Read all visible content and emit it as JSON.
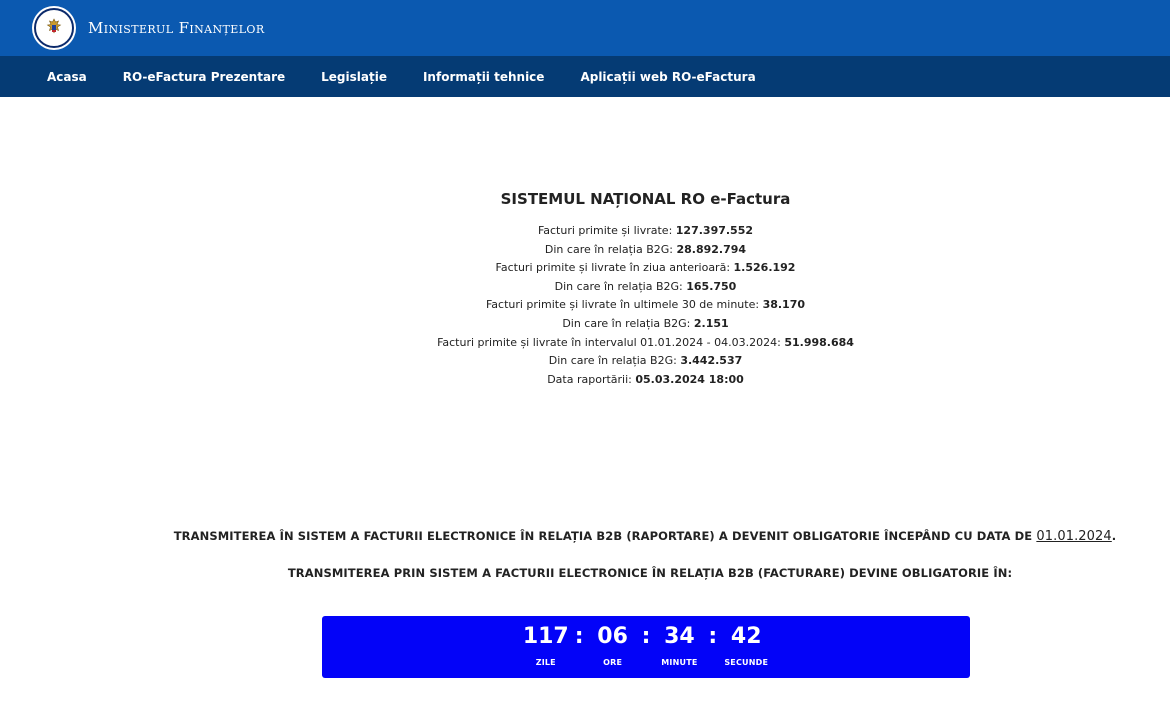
{
  "header": {
    "ministry_name": "Ministerul Finanțelor",
    "crest_icon": "romanian-government-crest-icon",
    "colors": {
      "topbar": "#0b59b0",
      "navbar": "#053b74"
    }
  },
  "nav": {
    "items": [
      {
        "label": "Acasa"
      },
      {
        "label": "RO-eFactura Prezentare"
      },
      {
        "label": "Legislație"
      },
      {
        "label": "Informații tehnice"
      },
      {
        "label": "Aplicații web RO-eFactura"
      }
    ]
  },
  "stats": {
    "title": "SISTEMUL NAȚIONAL RO e-Factura",
    "lines": [
      {
        "label": "Facturi primite și livrate: ",
        "value": "127.397.552"
      },
      {
        "label": "Din care în relația B2G: ",
        "value": "28.892.794"
      },
      {
        "label": "Facturi primite și livrate în ziua anterioară: ",
        "value": "1.526.192"
      },
      {
        "label": "Din care în relația B2G: ",
        "value": "165.750"
      },
      {
        "label": "Facturi primite și livrate în ultimele 30 de minute: ",
        "value": "38.170"
      },
      {
        "label": "Din care în relația B2G: ",
        "value": "2.151"
      },
      {
        "label": "Facturi primite și livrate în intervalul 01.01.2024 - 04.03.2024: ",
        "value": "51.998.684"
      },
      {
        "label": "Din care în relația B2G: ",
        "value": "3.442.537"
      },
      {
        "label": "Data raportării: ",
        "value": "05.03.2024 18:00"
      }
    ]
  },
  "notices": {
    "notice1_text": "TRANSMITEREA ÎN SISTEM A FACTURII ELECTRONICE ÎN RELAȚIA B2B (RAPORTARE) A DEVENIT OBLIGATORIE ÎNCEPÂND CU DATA DE ",
    "notice1_date": "01.01.2024",
    "notice1_end": ".",
    "notice2_text": "TRANSMITEREA PRIN SISTEM A FACTURII ELECTRONICE ÎN RELAȚIA B2B (FACTURARE) DEVINE OBLIGATORIE ÎN:"
  },
  "countdown": {
    "background_color": "#0303f8",
    "separator": ":",
    "units": [
      {
        "value": "117",
        "label": "ZILE"
      },
      {
        "value": "06",
        "label": "ORE"
      },
      {
        "value": "34",
        "label": "MINUTE"
      },
      {
        "value": "42",
        "label": "SECUNDE"
      }
    ]
  }
}
